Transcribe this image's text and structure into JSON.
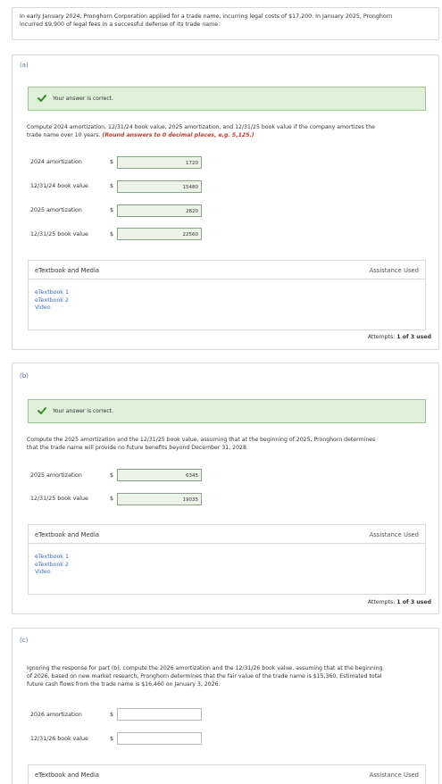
{
  "intro": {
    "line1": "In early January 2024, Pronghorn Corporation applied for a trade name, incurring legal costs of $17,200. In January 2025, Pronghorn",
    "line2": "incurred $9,900 of legal fees in a successful defense of its trade name."
  },
  "part_a": {
    "label": "(a)",
    "correct_text": "Your answer is correct.",
    "question_line1": "Compute 2024 amortization, 12/31/24 book value, 2025 amortization, and 12/31/25 book value if the company amortizes the",
    "question_line2_plain": "trade name over 10 years. ",
    "question_hint": "(Round answers to 0 decimal places, e.g. 5,125.)",
    "rows": [
      {
        "label": "2024 amortization",
        "currency": "$",
        "value": "1720"
      },
      {
        "label": "12/31/24 book value",
        "currency": "$",
        "value": "15480"
      },
      {
        "label": "2025 amortization",
        "currency": "$",
        "value": "2820"
      },
      {
        "label": "12/31/25 book value",
        "currency": "$",
        "value": "22560"
      }
    ],
    "etext_title": "eTextbook and Media",
    "assistance": "Assistance Used",
    "links": [
      "eTextbook 1",
      "eTextbook 2",
      "Video"
    ],
    "attempts_label": "Attempts: ",
    "attempts_value": "1 of 3 used"
  },
  "part_b": {
    "label": "(b)",
    "correct_text": "Your answer is correct.",
    "question_line1": "Compute the 2025 amortization and the 12/31/25 book value, assuming that at the beginning of 2025, Pronghorn determines",
    "question_line2": "that the trade name will provide no future benefits beyond December 31, 2028.",
    "rows": [
      {
        "label": "2025 amortization",
        "currency": "$",
        "value": "6345"
      },
      {
        "label": "12/31/25 book value",
        "currency": "$",
        "value": "19035"
      }
    ],
    "etext_title": "eTextbook and Media",
    "assistance": "Assistance Used",
    "links": [
      "eTextbook 1",
      "eTextbook 2",
      "Video"
    ],
    "attempts_label": "Attempts: ",
    "attempts_value": "1 of 3 used"
  },
  "part_c": {
    "label": "(c)",
    "question_line1": "Ignoring the response for part (b), compute the 2026 amortization and the 12/31/26 book value, assuming that at the beginning",
    "question_line2": "of 2026, based on new market research, Pronghorn determines that the fair value of the trade name is $15,360. Estimated total",
    "question_line3": "future cash flows from the trade name is $16,460 on January 3, 2026.",
    "rows": [
      {
        "label": "2026 amortization",
        "currency": "$",
        "value": ""
      },
      {
        "label": "12/31/26 book value",
        "currency": "$",
        "value": ""
      }
    ],
    "etext_title": "eTextbook and Media",
    "assistance": "Assistance Used"
  },
  "colors": {
    "correct_bg": "#dff0d8",
    "check_green": "#3c8a2e",
    "link_blue": "#3b6ec4",
    "hint_red": "#c0392b",
    "part_label": "#5a6fa8"
  }
}
